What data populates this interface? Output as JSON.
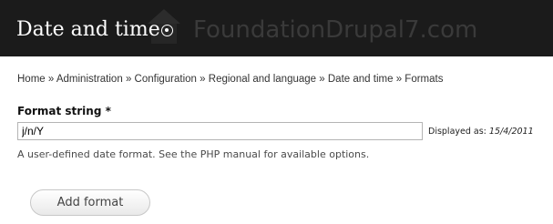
{
  "header": {
    "title": "Date and time",
    "shortcut_icon": "add-shortcut-icon",
    "watermark": "FoundationDrupal7.com",
    "background_color": "#1b1b1b"
  },
  "breadcrumb": {
    "items": [
      "Home",
      "Administration",
      "Configuration",
      "Regional and language",
      "Date and time",
      "Formats"
    ],
    "separator": "»"
  },
  "form": {
    "format_label": "Format string *",
    "format_value": "j/n/Y",
    "displayed_as_label": "Displayed as:",
    "displayed_as_value": "15/4/2011",
    "description": "A user-defined date format. See the PHP manual for available options.",
    "submit_label": "Add format"
  }
}
